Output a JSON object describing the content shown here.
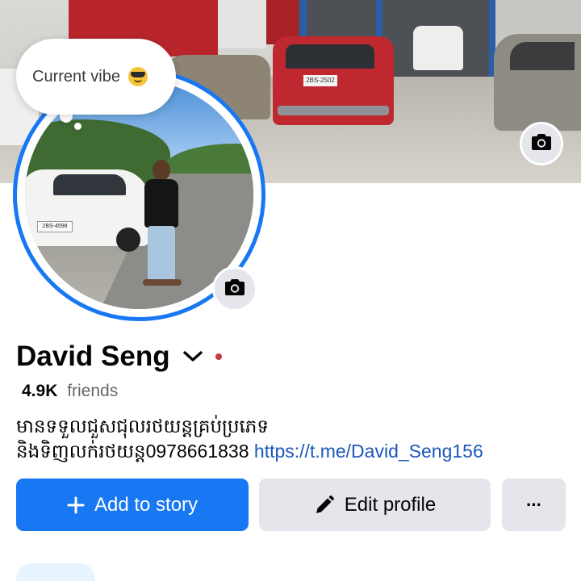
{
  "cover": {
    "red_car_plate": "2BS-2502",
    "camera_icon": "camera-icon"
  },
  "avatar": {
    "car_plate": "2BS-4598",
    "camera_icon": "camera-icon"
  },
  "status_bubble": {
    "text": "Current vibe",
    "emoji": "sunglasses-face-emoji"
  },
  "profile": {
    "name": "David Seng",
    "friends_count": "4.9K",
    "friends_label": "friends",
    "bio_line1": "មានទទួលជួសជុលរថយន្តគ្រប់ប្រភេទ",
    "bio_line2": "និងទិញលក់រថយន្ត0978661838",
    "bio_link": "https://t.me/David_Seng156"
  },
  "actions": {
    "add_story_label": "Add to story",
    "edit_profile_label": "Edit profile",
    "more_label": "···"
  },
  "colors": {
    "accent": "#1877f2",
    "secondary_button": "#e4e6eb",
    "link": "#1b58b8",
    "muted_text": "#65676b",
    "notification_dot": "#c53a45"
  }
}
